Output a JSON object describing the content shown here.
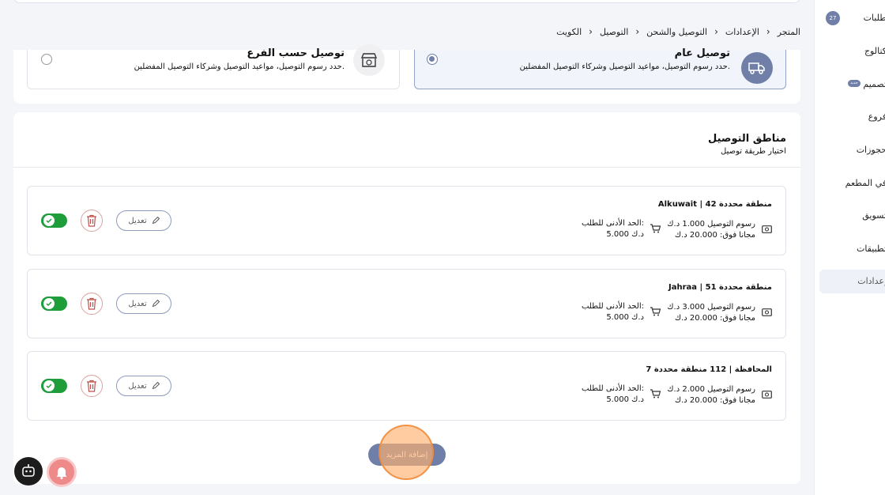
{
  "sidebar": {
    "items": [
      {
        "label": "طلبات",
        "badge": "27"
      },
      {
        "label": "كتالوج"
      },
      {
        "label": "تصميم",
        "badge": "جديد"
      },
      {
        "label": "فروع"
      },
      {
        "label": "حجوزات"
      },
      {
        "label": "في المطعم"
      },
      {
        "label": "تسويق"
      },
      {
        "label": "تطبيقات"
      },
      {
        "label": "إعدادات",
        "active": true
      }
    ]
  },
  "breadcrumb": [
    "المتجر",
    "الإعدادات",
    "التوصيل والشحن",
    "التوصيل",
    "الكويت"
  ],
  "delivery_type": {
    "general": {
      "title": "توصيل عام",
      "desc": "حدد رسوم التوصيل، مواعيد التوصيل وشركاء التوصيل المفضلين.",
      "selected": true,
      "icon": "truck-icon"
    },
    "branch": {
      "title": "توصيل حسب الفرع",
      "desc": "حدد رسوم التوصيل، مواعيد التوصيل وشركاء التوصيل المفضلين.",
      "selected": false,
      "icon": "store-icon"
    }
  },
  "zones_section": {
    "title": "مناطق التوصيل",
    "subtitle": "اختيار طريقة توصيل",
    "zones": [
      {
        "title": "Alkuwait | 42 منطقة محددة",
        "fee": "رسوم التوصيل 1.000 د.ك",
        "free_above": "مجانا فوق: 20.000 د.ك",
        "min_label": "الحد الأدنى للطلب:",
        "min_value": "5.000 د.ك",
        "edit_label": "تعديل",
        "enabled": true
      },
      {
        "title": "Jahraa | 51 منطقة محددة",
        "fee": "رسوم التوصيل 3.000 د.ك",
        "free_above": "مجانا فوق: 20.000 د.ك",
        "min_label": "الحد الأدنى للطلب:",
        "min_value": "5.000 د.ك",
        "edit_label": "تعديل",
        "enabled": true
      },
      {
        "title": "7 المحافظة | 112 منطقة محددة",
        "fee": "رسوم التوصيل 2.000 د.ك",
        "free_above": "مجانا فوق: 20.000 د.ك",
        "min_label": "الحد الأدنى للطلب:",
        "min_value": "5.000 د.ك",
        "edit_label": "تعديل",
        "enabled": true
      }
    ],
    "add_more_label": "إضافة المزيد"
  },
  "colors": {
    "accent": "#6f7fa8",
    "toggle_on": "#1f9d3a",
    "delete": "#c0514a"
  }
}
